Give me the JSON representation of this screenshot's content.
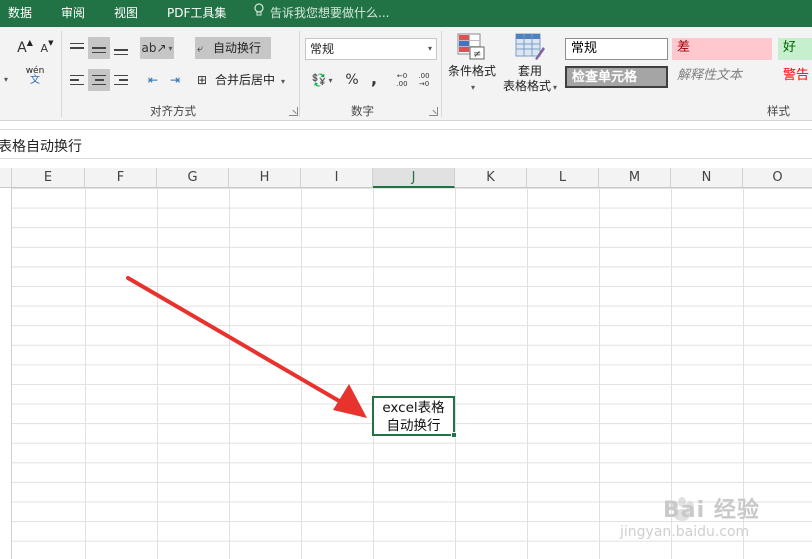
{
  "menubar": {
    "tabs": [
      "数据",
      "审阅",
      "视图",
      "PDF工具集"
    ],
    "tell_me": "告诉我您想要做什么..."
  },
  "ribbon": {
    "font": {
      "grow_label": "A",
      "shrink_label": "A",
      "wen_label": "wén",
      "wen_sub": "文"
    },
    "alignment": {
      "group_label": "对齐方式",
      "wrap_text": "自动换行",
      "merge_center": "合并后居中",
      "wrap_text_pressed": true
    },
    "number": {
      "group_label": "数字",
      "format_value": "常规",
      "percent": "%",
      "comma": ",",
      "inc_decimal": "←0 .00",
      "dec_decimal": ".00 →0"
    },
    "conditional_format": "条件格式",
    "table_format_line1": "套用",
    "table_format_line2": "表格格式",
    "styles": {
      "group_label": "样式",
      "normal": "常规",
      "bad": "差",
      "good": "好",
      "check_cell": "检查单元格",
      "explanatory": "解释性文本",
      "warning": "警告"
    }
  },
  "formula_bar": {
    "content": "表格自动换行"
  },
  "grid": {
    "columns": [
      "E",
      "F",
      "G",
      "H",
      "I",
      "J",
      "K",
      "L",
      "M",
      "N",
      "O"
    ],
    "active_column": "J",
    "active_cell_line1": "excel表格",
    "active_cell_line2": "自动换行"
  },
  "colors": {
    "accent": "#217346",
    "arrow": "#e8322d"
  },
  "watermark": {
    "brand": "Bai 经验",
    "url": "jingyan.baidu.com"
  }
}
